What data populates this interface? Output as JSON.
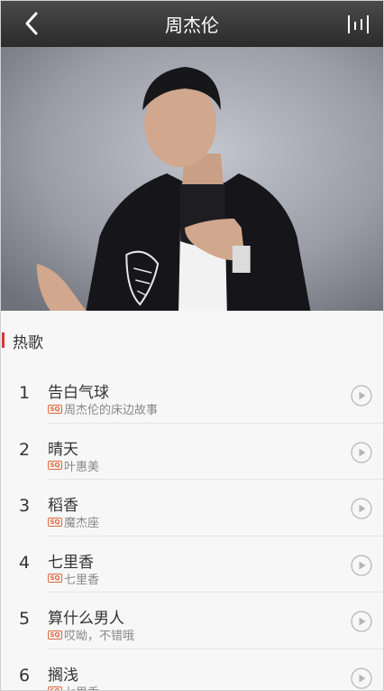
{
  "header": {
    "title": "周杰伦",
    "back_icon": "chevron-left-icon",
    "menu_icon": "now-playing-bars-icon"
  },
  "section": {
    "title": "热歌",
    "accent_color": "#d33a31"
  },
  "songs": [
    {
      "index": "1",
      "name": "告白气球",
      "badge": "SQ",
      "album": "周杰伦的床边故事"
    },
    {
      "index": "2",
      "name": "晴天",
      "badge": "SQ",
      "album": "叶惠美"
    },
    {
      "index": "3",
      "name": "稻香",
      "badge": "SQ",
      "album": "魔杰座"
    },
    {
      "index": "4",
      "name": "七里香",
      "badge": "SQ",
      "album": "七里香"
    },
    {
      "index": "5",
      "name": "算什么男人",
      "badge": "SQ",
      "album": "哎呦，不错哦"
    },
    {
      "index": "6",
      "name": "搁浅",
      "badge": "SQ",
      "album": "七里香"
    }
  ]
}
